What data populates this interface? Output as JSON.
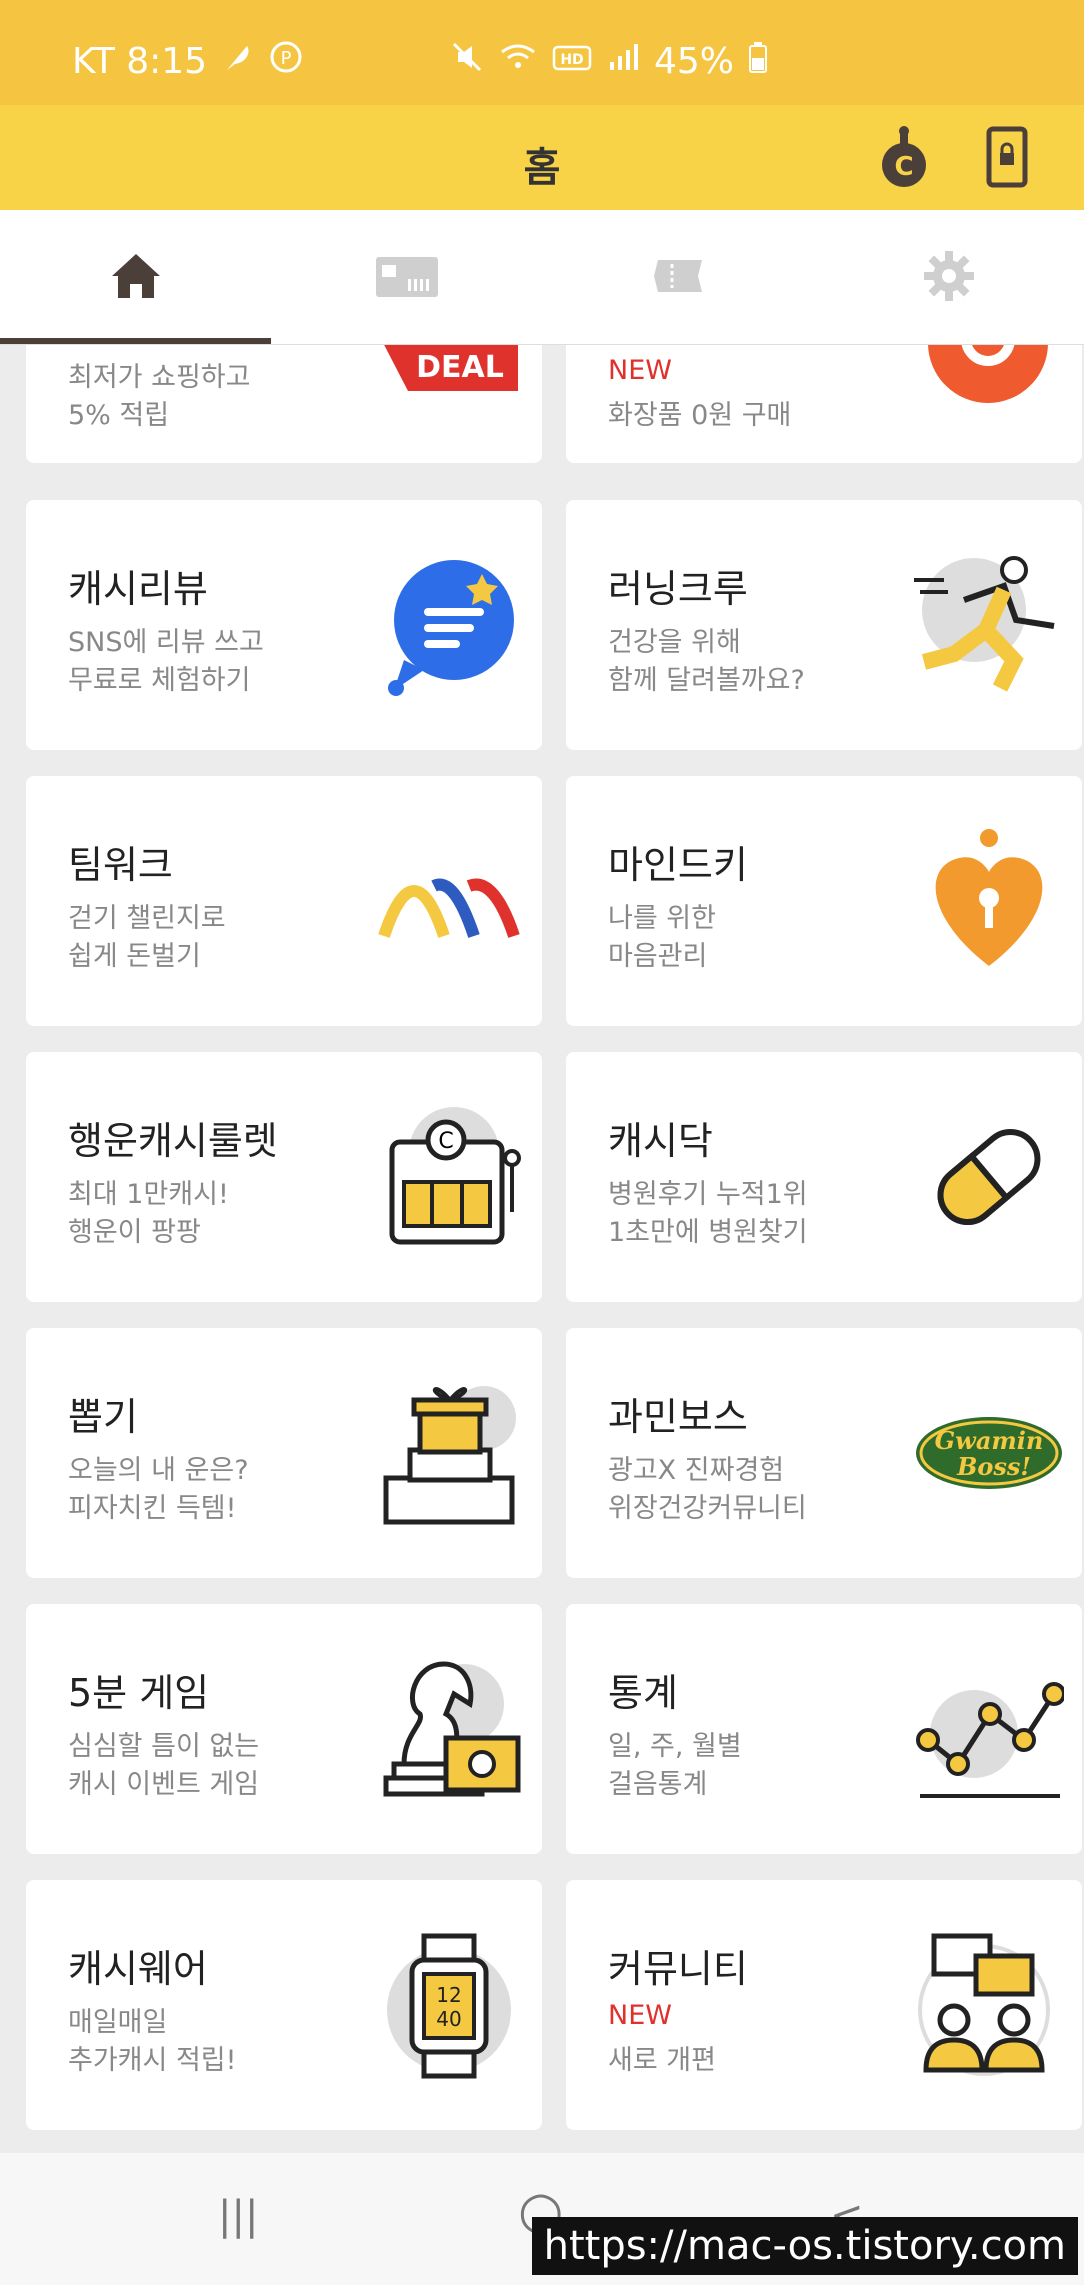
{
  "status_bar": {
    "carrier_time": "KT 8:15",
    "battery": "45%",
    "icons": [
      "feather-icon",
      "p-badge-icon",
      "mute-icon",
      "wifi-icon",
      "hd-icon",
      "signal-icon",
      "battery-icon"
    ]
  },
  "app_bar": {
    "title": "홈",
    "actions": [
      "cash-character-icon",
      "lock-phone-icon"
    ]
  },
  "tabs": {
    "items": [
      "home-icon",
      "gift-card-icon",
      "ticket-icon",
      "gear-icon"
    ],
    "active": 0
  },
  "cards": [
    {
      "title": "",
      "lines": [
        "최저가 쇼핑하고",
        "5% 적립"
      ],
      "icon": "deal-tag-icon"
    },
    {
      "title": "",
      "new": "NEW",
      "lines": [
        "화장품 0원 구매"
      ],
      "icon": "orange-gear-icon"
    },
    {
      "title": "캐시리뷰",
      "lines": [
        "SNS에 리뷰 쓰고",
        "무료로 체험하기"
      ],
      "icon": "chat-review-icon"
    },
    {
      "title": "러닝크루",
      "lines": [
        "건강을 위해",
        "함께 달려볼까요?"
      ],
      "icon": "runner-icon"
    },
    {
      "title": "팀워크",
      "lines": [
        "걷기 챌린지로",
        "쉽게 돈벌기"
      ],
      "icon": "teamwork-arcs-icon"
    },
    {
      "title": "마인드키",
      "lines": [
        "나를 위한",
        "마음관리"
      ],
      "icon": "heart-keyhole-icon"
    },
    {
      "title": "행운캐시룰렛",
      "lines": [
        "최대 1만캐시!",
        "행운이 팡팡"
      ],
      "icon": "slot-machine-icon"
    },
    {
      "title": "캐시닥",
      "lines": [
        "병원후기 누적1위",
        "1초만에 병원찾기"
      ],
      "icon": "pill-icon"
    },
    {
      "title": "뽑기",
      "lines": [
        "오늘의 내 운은?",
        "피자치킨 득템!"
      ],
      "icon": "gift-boxes-icon"
    },
    {
      "title": "과민보스",
      "lines": [
        "광고X 진짜경험",
        "위장건강커뮤니티"
      ],
      "icon": "gwamin-boss-logo-icon",
      "logo_text": "Gwamin Boss!"
    },
    {
      "title": "5분 게임",
      "lines": [
        "심심할 틈이 없는",
        "캐시 이벤트 게임"
      ],
      "icon": "chess-knight-icon"
    },
    {
      "title": "통계",
      "lines": [
        "일, 주, 월별",
        "걸음통계"
      ],
      "icon": "line-chart-icon"
    },
    {
      "title": "캐시웨어",
      "lines": [
        "매일매일",
        "추가캐시 적립!"
      ],
      "icon": "smartwatch-icon",
      "watch_time": [
        "12",
        "40"
      ]
    },
    {
      "title": "커뮤니티",
      "new": "NEW",
      "lines": [
        "새로 개편"
      ],
      "icon": "community-icon"
    }
  ],
  "nav_bar": {
    "recent": "|||",
    "home": "○",
    "back": "<"
  },
  "watermark": "https://mac-os.tistory.com",
  "colors": {
    "status_bg": "#f5c542",
    "appbar_bg": "#f8d247",
    "accent_yellow": "#f5c842",
    "new_red": "#e0322d"
  }
}
